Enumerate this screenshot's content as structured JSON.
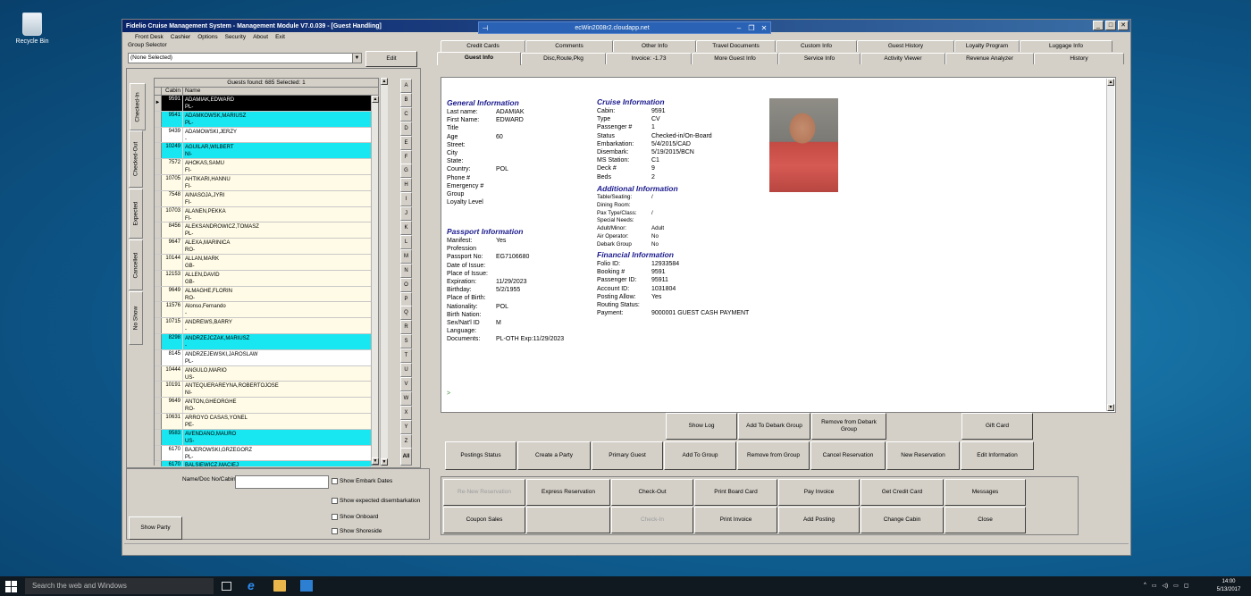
{
  "desktop": {
    "recycle_bin": "Recycle Bin"
  },
  "remote": {
    "host": "ecWin2008r2.cloudapp.net",
    "pin": "⊣",
    "min": "–",
    "restore": "❐",
    "close": "✕"
  },
  "window": {
    "title": "Fidelio Cruise Management System - Management Module V7.0.039 - [Guest Handling]",
    "min": "_",
    "max": "□",
    "close": "✕"
  },
  "menu": [
    "Front Desk",
    "Cashier",
    "Options",
    "Security",
    "About",
    "Exit"
  ],
  "left": {
    "group_selector_label": "Group Selector",
    "group_selector_value": "(None Selected)",
    "edit_button": "Edit",
    "vertical_tabs": [
      "Checked-In",
      "Checked-Out",
      "Expected",
      "Cancelled",
      "No Show"
    ],
    "guests_found": "Guests found: 685 Selected: 1",
    "col_cabin": "Cabin",
    "col_name": "Name",
    "alpha": [
      "A",
      "B",
      "C",
      "D",
      "E",
      "F",
      "G",
      "H",
      "I",
      "J",
      "K",
      "L",
      "M",
      "N",
      "O",
      "P",
      "Q",
      "R",
      "S",
      "T",
      "U",
      "V",
      "W",
      "X",
      "Y",
      "Z",
      "All"
    ],
    "name_label": "Name/Doc No/Cabin",
    "show_embark": "Show Embark Dates",
    "show_disembark": "Show expected disembarkation",
    "show_onboard": "Show Onboard",
    "show_shoreside": "Show Shoreside",
    "show_party": "Show Party",
    "selected_marker": "►",
    "colors": {
      "cyan": "#18e6f0",
      "cream": "#fffbe6",
      "white": "#ffffff",
      "selected": "#000000"
    },
    "guests": [
      {
        "cabin": "9591",
        "name": "ADAMIAK,EDWARD",
        "nat": "PL-",
        "color": "selected"
      },
      {
        "cabin": "9541",
        "name": "ADAMKOWSK,MARIUSZ",
        "nat": "PL-",
        "color": "cyan"
      },
      {
        "cabin": "9439",
        "name": "ADAMOWSKI,JERZY",
        "nat": "-",
        "color": "white"
      },
      {
        "cabin": "10249",
        "name": "AGUILAR,WILBERT",
        "nat": "NI-",
        "color": "cyan"
      },
      {
        "cabin": "7572",
        "name": "AHOKAS,SAMU",
        "nat": "FI-",
        "color": "cream"
      },
      {
        "cabin": "10705",
        "name": "AHTIKARI,HANNU",
        "nat": "FI-",
        "color": "cream"
      },
      {
        "cabin": "7548",
        "name": "AINASOJA,JYRI",
        "nat": "FI-",
        "color": "cream"
      },
      {
        "cabin": "10703",
        "name": "ALANEN,PEKKA",
        "nat": "FI-",
        "color": "cream"
      },
      {
        "cabin": "8456",
        "name": "ALEKSANDROWICZ,TOMASZ",
        "nat": "PL-",
        "color": "cream"
      },
      {
        "cabin": "9647",
        "name": "ALEXA,MARINICA",
        "nat": "RO-",
        "color": "cream"
      },
      {
        "cabin": "10144",
        "name": "ALLAN,MARK",
        "nat": "GB-",
        "color": "cream"
      },
      {
        "cabin": "12153",
        "name": "ALLEN,DAVID",
        "nat": "GB-",
        "color": "cream"
      },
      {
        "cabin": "9649",
        "name": "ALMAGHE,FLORIN",
        "nat": "RO-",
        "color": "cream"
      },
      {
        "cabin": "11576",
        "name": "Alonso,Fernando",
        "nat": "-",
        "color": "cream"
      },
      {
        "cabin": "10715",
        "name": "ANDREWS,BARRY",
        "nat": "-",
        "color": "cream"
      },
      {
        "cabin": "8298",
        "name": "ANDRZEJCZAK,MARIUSZ",
        "nat": "-",
        "color": "cyan"
      },
      {
        "cabin": "8145",
        "name": "ANDRZEJEWSKI,JAROSLAW",
        "nat": "PL-",
        "color": "white"
      },
      {
        "cabin": "10444",
        "name": "ANGULO,MARIO",
        "nat": "US-",
        "color": "cream"
      },
      {
        "cabin": "10191",
        "name": "ANTEQUERAREYNA,ROBERTOJOSE",
        "nat": "NI-",
        "color": "cream"
      },
      {
        "cabin": "9649",
        "name": "ANTON,GHEORGHE",
        "nat": "RO-",
        "color": "cream"
      },
      {
        "cabin": "10631",
        "name": "ARROYO CASAS,YONEL",
        "nat": "PE-",
        "color": "cream"
      },
      {
        "cabin": "9583",
        "name": "AVENDANO,MAURO",
        "nat": "US-",
        "color": "cyan"
      },
      {
        "cabin": "6170",
        "name": "BAJEROWSKI,GRZEGORZ",
        "nat": "PL-",
        "color": "white"
      },
      {
        "cabin": "6170",
        "name": "BALSIEWICZ,MACIEJ",
        "nat": "",
        "color": "cyan"
      }
    ]
  },
  "tabs_top": [
    "Credit Cards",
    "Comments",
    "Other Info",
    "Travel Documents",
    "Custom Info",
    "Guest History",
    "Loyalty Program",
    "Luggage Info"
  ],
  "tabs_bottom": [
    "Guest Info",
    "Disc,Route,Pkg",
    "Invoice: -1.73",
    "More Guest Info",
    "Service Info",
    "Activity Viewer",
    "Revenue Analyzer",
    "History"
  ],
  "info": {
    "general": {
      "title": "General Information",
      "rows": [
        [
          "Last name:",
          "ADAMIAK"
        ],
        [
          "First Name:",
          "EDWARD"
        ],
        [
          "Title",
          ""
        ],
        [
          "Age",
          "60"
        ],
        [
          "Street:",
          ""
        ],
        [
          "City",
          ""
        ],
        [
          "State:",
          ""
        ],
        [
          "Country:",
          "POL"
        ],
        [
          "Phone #",
          ""
        ],
        [
          "Emergency #",
          ""
        ],
        [
          "Group",
          ""
        ],
        [
          "Loyalty Level",
          ""
        ]
      ]
    },
    "passport": {
      "title": "Passport Information",
      "rows": [
        [
          "Manifest:",
          "Yes"
        ],
        [
          "Profession",
          ""
        ],
        [
          "Passport No:",
          "EG7106680"
        ],
        [
          "Date of Issue:",
          ""
        ],
        [
          "Place of Issue:",
          ""
        ],
        [
          "Expiration:",
          "11/29/2023"
        ],
        [
          "Birthday:",
          "5/2/1955"
        ],
        [
          "Place of Birth:",
          ""
        ],
        [
          "Nationality:",
          "POL"
        ],
        [
          "Birth Nation:",
          ""
        ],
        [
          "Sex/Nat'l ID",
          "M"
        ],
        [
          "Language:",
          ""
        ],
        [
          "Documents:",
          "PL-OTH Exp:11/29/2023"
        ]
      ]
    },
    "cruise": {
      "title": "Cruise Information",
      "rows": [
        [
          "Cabin:",
          "9591"
        ],
        [
          "Type",
          "CV"
        ],
        [
          "Passenger #",
          "1"
        ],
        [
          "Status",
          "Checked-in/On-Board"
        ],
        [
          "Embarkation:",
          "5/4/2015/CAD"
        ],
        [
          "Disembark:",
          "5/19/2015/BCN"
        ],
        [
          "MS Station:",
          "C1"
        ],
        [
          "Deck #",
          "9"
        ],
        [
          "Beds",
          "2"
        ]
      ]
    },
    "additional": {
      "title": "Additional Information",
      "rows": [
        [
          "Table/Seating:",
          "/"
        ],
        [
          "Dining Room:",
          ""
        ],
        [
          "Pax Type/Class:",
          "/"
        ],
        [
          "Special Needs:",
          ""
        ],
        [
          "Adult/Minor:",
          "Adult"
        ],
        [
          "Air Operator:",
          "No"
        ],
        [
          "Debark Group",
          "No"
        ]
      ]
    },
    "financial": {
      "title": "Financial Information",
      "rows": [
        [
          "Folio ID:",
          "12933584"
        ],
        [
          "Booking #",
          "9591"
        ],
        [
          "Passenger ID:",
          "95911"
        ],
        [
          "Account ID:",
          "1031804"
        ],
        [
          "Posting Allow:",
          "Yes"
        ],
        [
          "Routing Status:",
          ""
        ],
        [
          "Payment:",
          "9000001 GUEST CASH PAYMENT"
        ]
      ]
    },
    "prompt": ">"
  },
  "actions1": {
    "show_log": "Show Log",
    "add_debark": "Add To Debark Group",
    "remove_debark": "Remove from Debark Group",
    "gift_card": "Gift Card"
  },
  "actions2": [
    "Postings Status",
    "Create a Party",
    "Primary Guest",
    "Add To Group",
    "Remove from Group",
    "Cancel Reservation",
    "New Reservation",
    "Edit Information"
  ],
  "actions3": [
    "Re-New Reservation",
    "Express Reservation",
    "Check-Out",
    "Print Board Card",
    "Pay Invoice",
    "Get Credit Card",
    "Messages"
  ],
  "actions4": [
    "Coupon Sales",
    "",
    "Check-In",
    "Print Invoice",
    "Add Posting",
    "Change Cabin",
    "Close"
  ],
  "taskbar": {
    "search": "Search the web and Windows",
    "time": "14:00",
    "date": "5/13/2017"
  }
}
